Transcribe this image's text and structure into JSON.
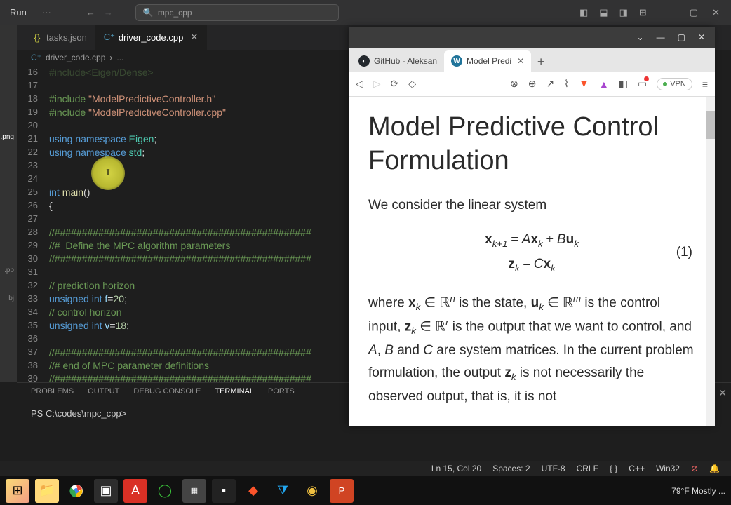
{
  "titlebar": {
    "run": "Run",
    "dots": "···",
    "search": "mpc_cpp"
  },
  "tabs": {
    "tasks": "tasks.json",
    "driver": "driver_code.cpp"
  },
  "breadcrumb": {
    "file": "driver_code.cpp",
    "sep": "›",
    "more": "..."
  },
  "activity": {
    "png": ".png",
    "pp": ".pp",
    "bj": "bj"
  },
  "code": {
    "l16": "#include<Eigen/Dense>",
    "l18a": "#include ",
    "l18b": "\"ModelPredictiveController.h\"",
    "l19a": "#include ",
    "l19b": "\"ModelPredictiveController.cpp\"",
    "l21a": "using",
    "l21b": " namespace ",
    "l21c": "Eigen",
    "l21d": ";",
    "l22a": "using",
    "l22b": " namespace ",
    "l22c": "std",
    "l22d": ";",
    "l25a": "int",
    "l25b": " ",
    "l25c": "main",
    "l25d": "()",
    "l26": "{",
    "l28": "//###############################################",
    "l29": "//#  Define the MPC algorithm parameters",
    "l30": "//###############################################",
    "l32": "// prediction horizon",
    "l33a": "unsigned",
    "l33b": " int ",
    "l33c": "f",
    "l33d": "=",
    "l33e": "20",
    "l33f": ";",
    "l34": "// control horizon",
    "l35a": "unsigned",
    "l35b": " int ",
    "l35c": "v",
    "l35d": "=",
    "l35e": "18",
    "l35f": ";",
    "l37": "//###############################################",
    "l38": "//# end of MPC parameter definitions",
    "l39": "//###############################################"
  },
  "panel": {
    "problems": "PROBLEMS",
    "output": "OUTPUT",
    "debug": "DEBUG CONSOLE",
    "terminal": "TERMINAL",
    "ports": "PORTS",
    "prompt": "PS C:\\codes\\mpc_cpp>"
  },
  "status": {
    "lncol": "Ln 15, Col 20",
    "spaces": "Spaces: 2",
    "enc": "UTF-8",
    "eol": "CRLF",
    "lang": "C++",
    "arch": "Win32",
    "prettier": "⊘"
  },
  "browser": {
    "tab1": "GitHub - Aleksan",
    "tab2": "Model Predi",
    "vpn": "VPN",
    "title": "Model Predictive Control Formulation",
    "p1": "We consider the linear system",
    "eqnum": "(1)",
    "p2a": "where ",
    "p2b": " is the state, ",
    "p2c": " is the control input, ",
    "p2d": " is the output that we want to control, and ",
    "p2e": " and ",
    "p2f": " are system matrices. In the current problem formulation, the output ",
    "p2g": " is not necessarily the observed output, that is, it is not"
  },
  "taskbar": {
    "weather": "79°F  Mostly ..."
  }
}
